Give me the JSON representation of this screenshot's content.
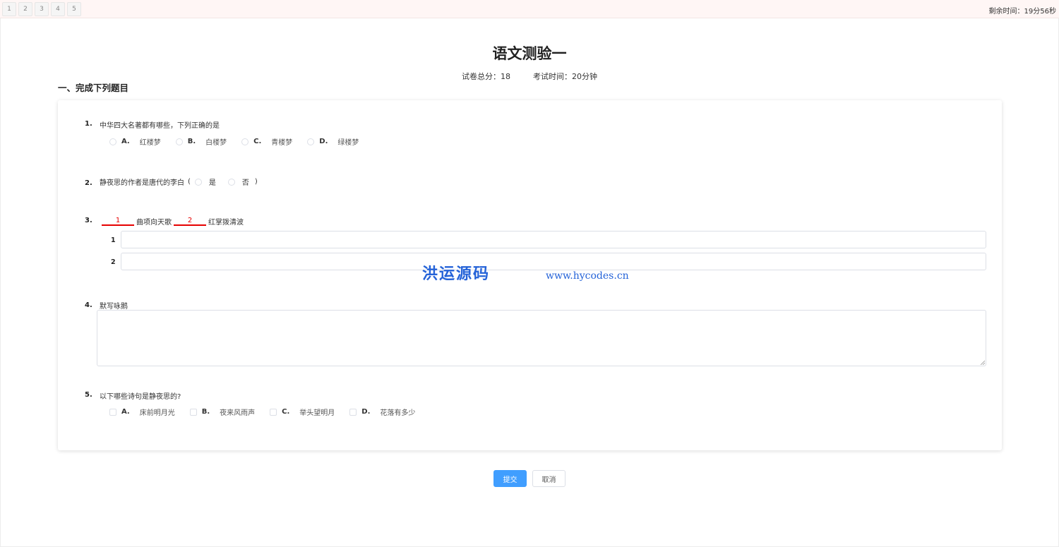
{
  "nav": {
    "questions": [
      "1",
      "2",
      "3",
      "4",
      "5"
    ],
    "timer_label": "剩余时间：",
    "timer_value": "19分56秒"
  },
  "exam": {
    "title": "语文测验一",
    "total_label": "试卷总分：",
    "total_value": "18",
    "time_label": "考试时间：",
    "time_value": "20分钟"
  },
  "section": {
    "title": "一、完成下列题目"
  },
  "questions": [
    {
      "number": "1.",
      "text": "中华四大名著都有哪些，下列正确的是",
      "options": [
        {
          "letter": "A.",
          "text": "红楼梦"
        },
        {
          "letter": "B.",
          "text": "白楼梦"
        },
        {
          "letter": "C.",
          "text": "青楼梦"
        },
        {
          "letter": "D.",
          "text": "绿楼梦"
        }
      ]
    },
    {
      "number": "2.",
      "text": "静夜思的作者是唐代的李白",
      "open_paren": "(",
      "close_paren": ")",
      "options": [
        {
          "text": "是"
        },
        {
          "text": "否"
        }
      ]
    },
    {
      "number": "3.",
      "blank1": "1",
      "middle_text": "曲项向天歌",
      "blank2": "2",
      "end_text": "红掌拨清波",
      "sub_labels": [
        "1",
        "2"
      ]
    },
    {
      "number": "4.",
      "text": "默写咏鹅"
    },
    {
      "number": "5.",
      "text": "以下哪些诗句是静夜思的?",
      "options": [
        {
          "letter": "A.",
          "text": "床前明月光"
        },
        {
          "letter": "B.",
          "text": "夜来风雨声"
        },
        {
          "letter": "C.",
          "text": "举头望明月"
        },
        {
          "letter": "D.",
          "text": "花落有多少"
        }
      ]
    }
  ],
  "watermark": {
    "text": "洪运源码",
    "url": "www.hycodes.cn"
  },
  "actions": {
    "submit_label": "提交",
    "cancel_label": "取消"
  },
  "colors": {
    "primary": "#409eff",
    "blank_red": "#e60000",
    "watermark_blue": "#2563d8"
  }
}
